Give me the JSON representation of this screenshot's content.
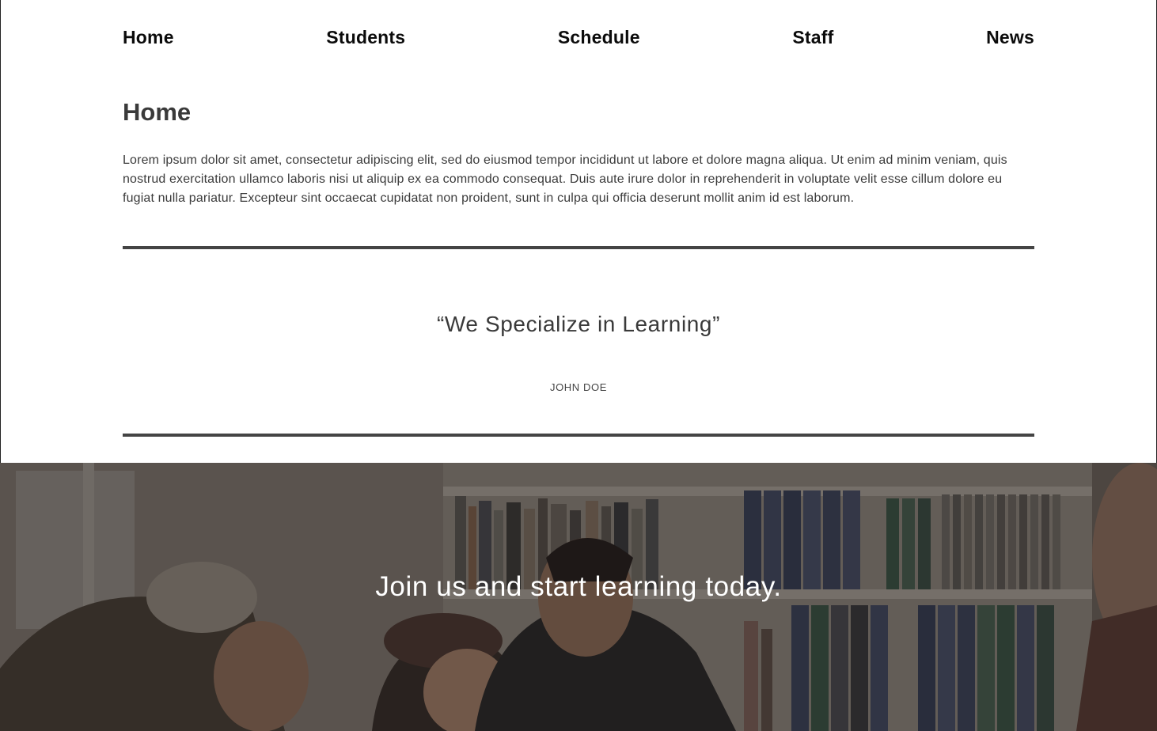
{
  "nav": {
    "items": [
      {
        "label": "Home"
      },
      {
        "label": "Students"
      },
      {
        "label": "Schedule"
      },
      {
        "label": "Staff"
      },
      {
        "label": "News"
      }
    ]
  },
  "main": {
    "title": "Home",
    "intro": "Lorem ipsum dolor sit amet, consectetur adipiscing elit, sed do eiusmod tempor incididunt ut labore et dolore magna aliqua. Ut enim ad minim veniam, quis nostrud exercitation ullamco laboris nisi ut aliquip ex ea commodo consequat. Duis aute irure dolor in reprehenderit in voluptate velit esse cillum dolore eu fugiat nulla pariatur. Excepteur sint occaecat cupidatat non proident, sunt in culpa qui officia deserunt mollit anim id est laborum."
  },
  "testimonial": {
    "quote": "“We Specialize in Learning”",
    "author": "JOHN DOE"
  },
  "hero": {
    "heading": "Join us and start learning today.",
    "overlay_color": "#000000"
  }
}
